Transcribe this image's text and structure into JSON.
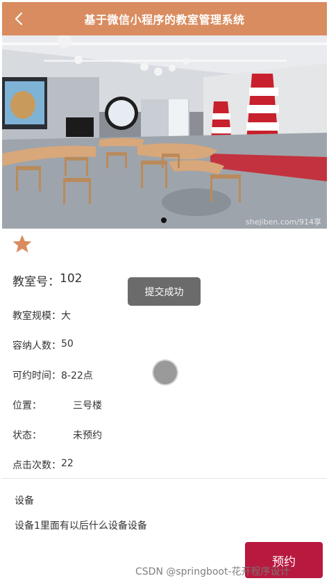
{
  "header": {
    "title": "基于微信小程序的教室管理系统"
  },
  "carousel": {
    "photo_watermark": "shejiben.com/914享"
  },
  "room": {
    "label": "教室号：",
    "value": "102"
  },
  "details": [
    {
      "key": "教室规模：",
      "value": "大"
    },
    {
      "key": "容纳人数：",
      "value": "50"
    },
    {
      "key": "可约时间：",
      "value": "8-22点"
    },
    {
      "key": "位置：",
      "value": "三号楼"
    },
    {
      "key": "状态：",
      "value": "未预约"
    },
    {
      "key": "点击次数：",
      "value": "22"
    }
  ],
  "equipment": {
    "title": "设备",
    "description": "设备1里面有以后什么设备设备"
  },
  "toast": {
    "text": "提交成功"
  },
  "actions": {
    "reserve_label": "预约"
  },
  "watermark": {
    "text": "CSDN @springboot-花开程序设计"
  },
  "colors": {
    "header": "#d98c5f",
    "star": "#d98c5f",
    "reserve_button": "#b8193f"
  },
  "icons": {
    "back": "back-icon",
    "favorite": "star-icon"
  }
}
